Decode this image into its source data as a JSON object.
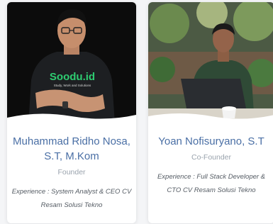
{
  "team": [
    {
      "name": "Muhammad Ridho Nosa, S.T, M.Kom",
      "role": "Founder",
      "experience": "Experience : System Analyst & CEO CV Resam Solusi Tekno",
      "shirt_text": "Soodu.id",
      "shirt_subtext": "Study, Work and Solutions"
    },
    {
      "name": "Yoan Nofisuryano, S.T",
      "role": "Co-Founder",
      "experience": "Experience : Full Stack Developer & CTO CV Resam Solusi Tekno"
    }
  ],
  "colors": {
    "name": "#4a6fa5",
    "role": "#9aa3ad",
    "experience": "#555c64",
    "card": "#ffffff",
    "background": "#f4f5f7"
  }
}
